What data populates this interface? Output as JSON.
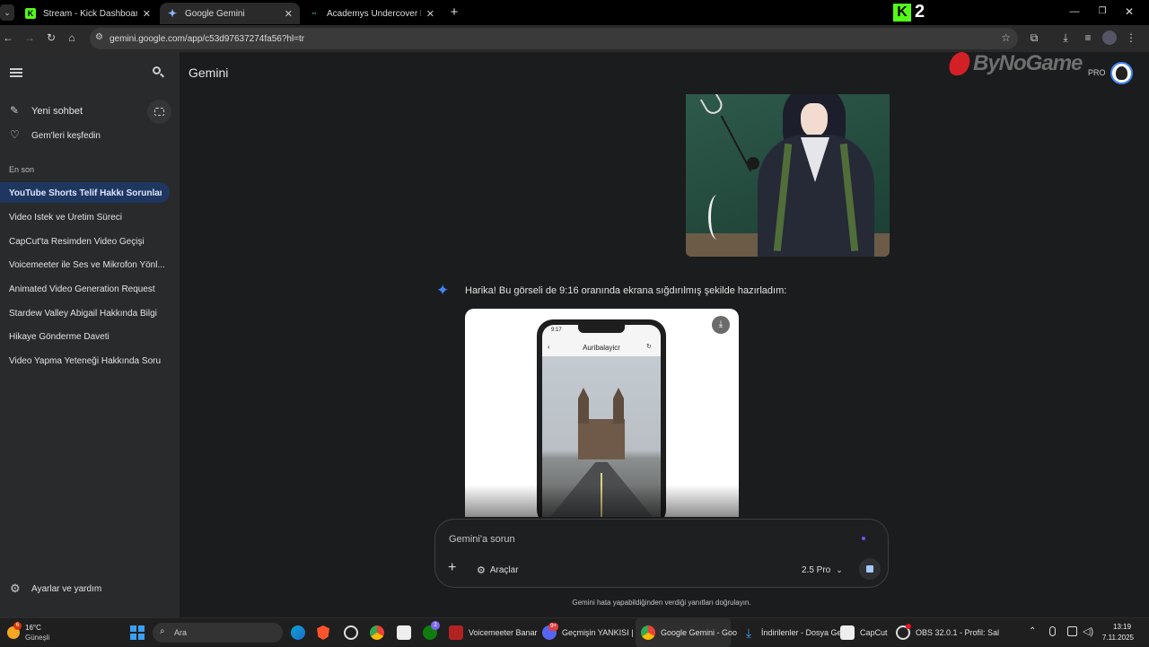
{
  "browser": {
    "tabs": [
      {
        "title": "Stream - Kick Dashboard",
        "favicon": "kick-icon"
      },
      {
        "title": "Google Gemini",
        "favicon": "gemini-icon",
        "active": true
      },
      {
        "title": "Academys Undercover Professo",
        "favicon": "tab-icon"
      }
    ],
    "url": "gemini.google.com/app/c53d97637274fa56?hl=tr"
  },
  "overlay": {
    "stream_badge": "2",
    "watermark": "ByNoGame"
  },
  "header": {
    "app_title": "Gemini",
    "pro_label": "PRO"
  },
  "sidebar": {
    "new_chat": "Yeni sohbet",
    "explore_gems": "Gem'leri keşfedin",
    "recent_title": "En son",
    "recent_items": [
      "YouTube Shorts Telif Hakkı Sorunları ...",
      "Video İstek ve Üretim Süreci",
      "CapCut'ta Resimden Video Geçişi",
      "Voicemeeter ile Ses ve Mikrofon Yönl...",
      "Animated Video Generation Request",
      "Stardew Valley Abigail Hakkında Bilgi",
      "Hikaye Gönderme Daveti",
      "Video Yapma Yeteneği Hakkında Soru"
    ],
    "settings": "Ayarlar ve yardım"
  },
  "chat": {
    "response_text": "Harika! Bu görseli de 9:16 oranında ekrana sığdırılmış şekilde hazırladım:",
    "phone_time": "9:17",
    "phone_app_title": "Auribalayicr"
  },
  "input": {
    "placeholder": "Gemini'a sorun",
    "tools_label": "Araçlar",
    "model_label": "2.5 Pro",
    "disclaimer": "Gemini hata yapabildiğinden verdiği yanıtları doğrulayın."
  },
  "taskbar": {
    "weather_temp": "16°C",
    "weather_desc": "Güneşli",
    "weather_badge": "6",
    "search_placeholder": "Ara",
    "xbox_badge": "2",
    "discord_badge": "9+",
    "apps": [
      {
        "label": "Voicemeeter Banar",
        "icon": "voicemeeter-icon"
      },
      {
        "label": "Geçmişin YANKISI | Ur",
        "icon": "discord-icon"
      },
      {
        "label": "Google Gemini - Goo",
        "icon": "chrome-icon"
      },
      {
        "label": "İndirilenler - Dosya Ge",
        "icon": "download-icon"
      },
      {
        "label": "CapCut",
        "icon": "capcut-icon"
      },
      {
        "label": "OBS 32.0.1 - Profil: Sal",
        "icon": "obs-icon"
      }
    ],
    "time": "13:19",
    "date": "7.11.2025"
  },
  "colors": {
    "accent_blue": "#8ab4f8",
    "selected_chat_bg": "#1f3760",
    "kick_green": "#53fc18",
    "gemini_gradient": "#4285f4"
  }
}
